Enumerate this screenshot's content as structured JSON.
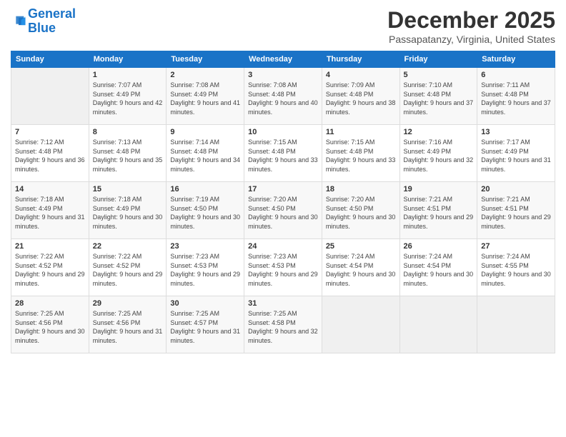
{
  "logo": {
    "line1": "General",
    "line2": "Blue"
  },
  "title": "December 2025",
  "location": "Passapatanzy, Virginia, United States",
  "days_header": [
    "Sunday",
    "Monday",
    "Tuesday",
    "Wednesday",
    "Thursday",
    "Friday",
    "Saturday"
  ],
  "weeks": [
    [
      {
        "day": "",
        "empty": true
      },
      {
        "day": "1",
        "sunrise": "Sunrise: 7:07 AM",
        "sunset": "Sunset: 4:49 PM",
        "daylight": "Daylight: 9 hours and 42 minutes."
      },
      {
        "day": "2",
        "sunrise": "Sunrise: 7:08 AM",
        "sunset": "Sunset: 4:49 PM",
        "daylight": "Daylight: 9 hours and 41 minutes."
      },
      {
        "day": "3",
        "sunrise": "Sunrise: 7:08 AM",
        "sunset": "Sunset: 4:48 PM",
        "daylight": "Daylight: 9 hours and 40 minutes."
      },
      {
        "day": "4",
        "sunrise": "Sunrise: 7:09 AM",
        "sunset": "Sunset: 4:48 PM",
        "daylight": "Daylight: 9 hours and 38 minutes."
      },
      {
        "day": "5",
        "sunrise": "Sunrise: 7:10 AM",
        "sunset": "Sunset: 4:48 PM",
        "daylight": "Daylight: 9 hours and 37 minutes."
      },
      {
        "day": "6",
        "sunrise": "Sunrise: 7:11 AM",
        "sunset": "Sunset: 4:48 PM",
        "daylight": "Daylight: 9 hours and 37 minutes."
      }
    ],
    [
      {
        "day": "7",
        "sunrise": "Sunrise: 7:12 AM",
        "sunset": "Sunset: 4:48 PM",
        "daylight": "Daylight: 9 hours and 36 minutes."
      },
      {
        "day": "8",
        "sunrise": "Sunrise: 7:13 AM",
        "sunset": "Sunset: 4:48 PM",
        "daylight": "Daylight: 9 hours and 35 minutes."
      },
      {
        "day": "9",
        "sunrise": "Sunrise: 7:14 AM",
        "sunset": "Sunset: 4:48 PM",
        "daylight": "Daylight: 9 hours and 34 minutes."
      },
      {
        "day": "10",
        "sunrise": "Sunrise: 7:15 AM",
        "sunset": "Sunset: 4:48 PM",
        "daylight": "Daylight: 9 hours and 33 minutes."
      },
      {
        "day": "11",
        "sunrise": "Sunrise: 7:15 AM",
        "sunset": "Sunset: 4:48 PM",
        "daylight": "Daylight: 9 hours and 33 minutes."
      },
      {
        "day": "12",
        "sunrise": "Sunrise: 7:16 AM",
        "sunset": "Sunset: 4:49 PM",
        "daylight": "Daylight: 9 hours and 32 minutes."
      },
      {
        "day": "13",
        "sunrise": "Sunrise: 7:17 AM",
        "sunset": "Sunset: 4:49 PM",
        "daylight": "Daylight: 9 hours and 31 minutes."
      }
    ],
    [
      {
        "day": "14",
        "sunrise": "Sunrise: 7:18 AM",
        "sunset": "Sunset: 4:49 PM",
        "daylight": "Daylight: 9 hours and 31 minutes."
      },
      {
        "day": "15",
        "sunrise": "Sunrise: 7:18 AM",
        "sunset": "Sunset: 4:49 PM",
        "daylight": "Daylight: 9 hours and 30 minutes."
      },
      {
        "day": "16",
        "sunrise": "Sunrise: 7:19 AM",
        "sunset": "Sunset: 4:50 PM",
        "daylight": "Daylight: 9 hours and 30 minutes."
      },
      {
        "day": "17",
        "sunrise": "Sunrise: 7:20 AM",
        "sunset": "Sunset: 4:50 PM",
        "daylight": "Daylight: 9 hours and 30 minutes."
      },
      {
        "day": "18",
        "sunrise": "Sunrise: 7:20 AM",
        "sunset": "Sunset: 4:50 PM",
        "daylight": "Daylight: 9 hours and 30 minutes."
      },
      {
        "day": "19",
        "sunrise": "Sunrise: 7:21 AM",
        "sunset": "Sunset: 4:51 PM",
        "daylight": "Daylight: 9 hours and 29 minutes."
      },
      {
        "day": "20",
        "sunrise": "Sunrise: 7:21 AM",
        "sunset": "Sunset: 4:51 PM",
        "daylight": "Daylight: 9 hours and 29 minutes."
      }
    ],
    [
      {
        "day": "21",
        "sunrise": "Sunrise: 7:22 AM",
        "sunset": "Sunset: 4:52 PM",
        "daylight": "Daylight: 9 hours and 29 minutes."
      },
      {
        "day": "22",
        "sunrise": "Sunrise: 7:22 AM",
        "sunset": "Sunset: 4:52 PM",
        "daylight": "Daylight: 9 hours and 29 minutes."
      },
      {
        "day": "23",
        "sunrise": "Sunrise: 7:23 AM",
        "sunset": "Sunset: 4:53 PM",
        "daylight": "Daylight: 9 hours and 29 minutes."
      },
      {
        "day": "24",
        "sunrise": "Sunrise: 7:23 AM",
        "sunset": "Sunset: 4:53 PM",
        "daylight": "Daylight: 9 hours and 29 minutes."
      },
      {
        "day": "25",
        "sunrise": "Sunrise: 7:24 AM",
        "sunset": "Sunset: 4:54 PM",
        "daylight": "Daylight: 9 hours and 30 minutes."
      },
      {
        "day": "26",
        "sunrise": "Sunrise: 7:24 AM",
        "sunset": "Sunset: 4:54 PM",
        "daylight": "Daylight: 9 hours and 30 minutes."
      },
      {
        "day": "27",
        "sunrise": "Sunrise: 7:24 AM",
        "sunset": "Sunset: 4:55 PM",
        "daylight": "Daylight: 9 hours and 30 minutes."
      }
    ],
    [
      {
        "day": "28",
        "sunrise": "Sunrise: 7:25 AM",
        "sunset": "Sunset: 4:56 PM",
        "daylight": "Daylight: 9 hours and 30 minutes."
      },
      {
        "day": "29",
        "sunrise": "Sunrise: 7:25 AM",
        "sunset": "Sunset: 4:56 PM",
        "daylight": "Daylight: 9 hours and 31 minutes."
      },
      {
        "day": "30",
        "sunrise": "Sunrise: 7:25 AM",
        "sunset": "Sunset: 4:57 PM",
        "daylight": "Daylight: 9 hours and 31 minutes."
      },
      {
        "day": "31",
        "sunrise": "Sunrise: 7:25 AM",
        "sunset": "Sunset: 4:58 PM",
        "daylight": "Daylight: 9 hours and 32 minutes."
      },
      {
        "day": "",
        "empty": true
      },
      {
        "day": "",
        "empty": true
      },
      {
        "day": "",
        "empty": true
      }
    ]
  ]
}
